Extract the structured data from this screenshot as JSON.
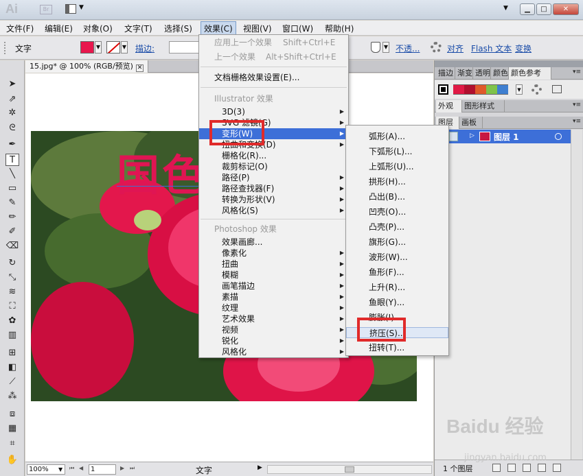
{
  "titlebar": {
    "logo": "Ai",
    "bridge": "Br",
    "win_min": "▁",
    "win_max": "□",
    "win_close": "✕"
  },
  "menubar": [
    "文件(F)",
    "编辑(E)",
    "对象(O)",
    "文字(T)",
    "选择(S)",
    "效果(C)",
    "视图(V)",
    "窗口(W)",
    "帮助(H)"
  ],
  "controlbar": {
    "label": "文字",
    "fill_color": "#e8174d",
    "stroke_label": "描边:",
    "opacity_link": "不透...",
    "align_link": "对齐",
    "flash_link": "Flash 文本",
    "transform_link": "变换"
  },
  "document": {
    "tab_title": "15.jpg* @ 100% (RGB/预览)",
    "tab_close": "✕",
    "art_text": "国色",
    "zoom": "100%",
    "page": "1",
    "status_text": "文字"
  },
  "effect_menu": {
    "items": [
      {
        "label": "应用上一个效果",
        "shortcut": "Shift+Ctrl+E",
        "disabled": true
      },
      {
        "label": "上一个效果",
        "shortcut": "Alt+Shift+Ctrl+E",
        "disabled": true
      },
      {
        "label": "文档栅格效果设置(E)..."
      }
    ],
    "section_illustrator": "Illustrator 效果",
    "illustrator_items": [
      "3D(3)",
      "SVG 滤镜(G)",
      "变形(W)",
      "扭曲和变换(D)",
      "栅格化(R)...",
      "裁剪标记(O)",
      "路径(P)",
      "路径查找器(F)",
      "转换为形状(V)",
      "风格化(S)"
    ],
    "section_photoshop": "Photoshop 效果",
    "photoshop_items": [
      "效果画廊...",
      "像素化",
      "扭曲",
      "模糊",
      "画笔描边",
      "素描",
      "纹理",
      "艺术效果",
      "视频",
      "锐化",
      "风格化"
    ]
  },
  "warp_submenu": [
    "弧形(A)...",
    "下弧形(L)...",
    "上弧形(U)...",
    "拱形(H)...",
    "凸出(B)...",
    "凹壳(O)...",
    "凸壳(P)...",
    "旗形(G)...",
    "波形(W)...",
    "鱼形(F)...",
    "上升(R)...",
    "鱼眼(Y)...",
    "膨胀(I)...",
    "挤压(S)...",
    "扭转(T)..."
  ],
  "right_panels": {
    "tabs_top": [
      "描边",
      "渐变",
      "透明",
      "颜色",
      "颜色参考"
    ],
    "guide_colors": [
      "#e01a45",
      "#b0102e",
      "#e05a2a",
      "#7fc34a",
      "#3f7fd0"
    ],
    "tabs_mid": [
      "外观",
      "图形样式"
    ],
    "tabs_layers": [
      "图层",
      "画板"
    ],
    "layer_name": "图层 1",
    "layer_count": "1 个图层"
  },
  "watermark": {
    "brand": "Baidu 经验",
    "url": "jingyan.baidu.com"
  }
}
